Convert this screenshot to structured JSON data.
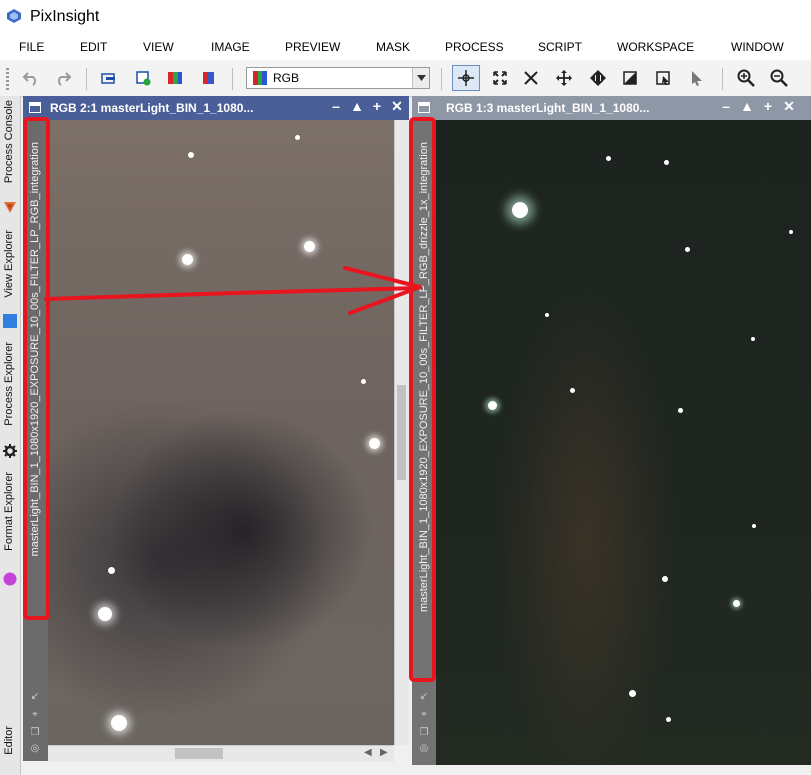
{
  "app": {
    "title": "PixInsight",
    "logo_icon": "pixinsight-logo-icon"
  },
  "menu": [
    "FILE",
    "EDIT",
    "VIEW",
    "IMAGE",
    "PREVIEW",
    "MASK",
    "PROCESS",
    "SCRIPT",
    "WORKSPACE",
    "WINDOW"
  ],
  "toolbar": {
    "view_select_value": "RGB",
    "icons": [
      "undo-icon",
      "redo-icon",
      "screen-transfer-icon",
      "new-image-icon",
      "rgb-channels-icon",
      "color-management-icon",
      "readout-mode-icon",
      "zoom-in-out-mode-icon",
      "fit-view-icon",
      "pan-mode-icon",
      "move-all-icon",
      "mask-icon",
      "preview-edit-icon",
      "select-icon",
      "zoom-in-icon",
      "zoom-out-icon"
    ]
  },
  "sidebar": {
    "tabs": [
      "Process Console",
      "View Explorer",
      "Process Explorer",
      "Format Explorer",
      "Editor"
    ]
  },
  "windows": [
    {
      "caption": "RGB 2:1 masterLight_BIN_1_1080...",
      "identifier": "masterLight_BIN_1_1080x1920_EXPOSURE_10_00s_FILTER_LP_RGB_integration",
      "active": true
    },
    {
      "caption": "RGB 1:3 masterLight_BIN_1_1080...",
      "identifier": "masterLight_BIN_1_1080x1920_EXPOSURE_10_00s_FILTER_LP_RGB_drizzle_1x_integration",
      "active": false
    }
  ],
  "colors": {
    "accent": "#4a5f97",
    "annotation": "#e8141e"
  }
}
